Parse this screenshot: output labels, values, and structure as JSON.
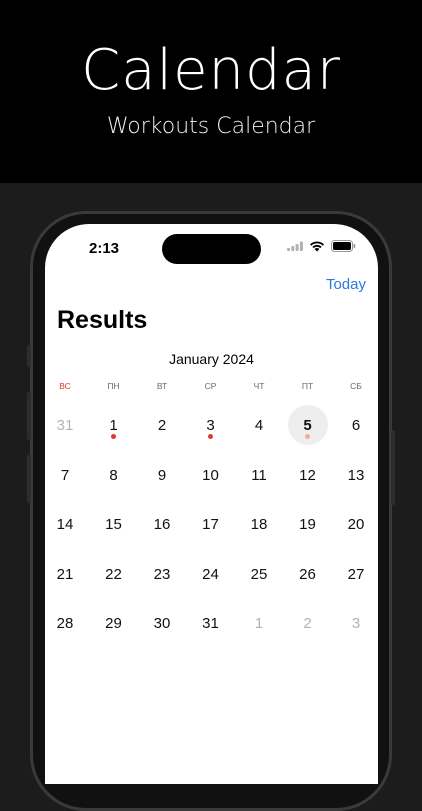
{
  "promo": {
    "title": "Calendar",
    "subtitle": "Workouts Calendar"
  },
  "status_bar": {
    "time": "2:13"
  },
  "header": {
    "today_label": "Today",
    "title": "Results"
  },
  "calendar": {
    "month_label": "January 2024",
    "weekdays": [
      "ВС",
      "ПН",
      "ВТ",
      "СР",
      "ЧТ",
      "ПТ",
      "СБ"
    ],
    "weeks": [
      [
        {
          "label": "31",
          "other": true
        },
        {
          "label": "1",
          "dot": true
        },
        {
          "label": "2"
        },
        {
          "label": "3",
          "dot": true
        },
        {
          "label": "4"
        },
        {
          "label": "5",
          "today": true,
          "dot": true
        },
        {
          "label": "6"
        }
      ],
      [
        {
          "label": "7"
        },
        {
          "label": "8"
        },
        {
          "label": "9"
        },
        {
          "label": "10"
        },
        {
          "label": "11"
        },
        {
          "label": "12"
        },
        {
          "label": "13"
        }
      ],
      [
        {
          "label": "14"
        },
        {
          "label": "15"
        },
        {
          "label": "16"
        },
        {
          "label": "17"
        },
        {
          "label": "18"
        },
        {
          "label": "19"
        },
        {
          "label": "20"
        }
      ],
      [
        {
          "label": "21"
        },
        {
          "label": "22"
        },
        {
          "label": "23"
        },
        {
          "label": "24"
        },
        {
          "label": "25"
        },
        {
          "label": "26"
        },
        {
          "label": "27"
        }
      ],
      [
        {
          "label": "28"
        },
        {
          "label": "29"
        },
        {
          "label": "30"
        },
        {
          "label": "31"
        },
        {
          "label": "1",
          "other": true
        },
        {
          "label": "2",
          "other": true
        },
        {
          "label": "3",
          "other": true
        }
      ]
    ]
  },
  "colors": {
    "accent": "#2a7ae2",
    "workout_dot": "#e03a2f",
    "sunday": "#e03a2f"
  },
  "icons": [
    "cellular-icon",
    "wifi-icon",
    "battery-icon"
  ]
}
